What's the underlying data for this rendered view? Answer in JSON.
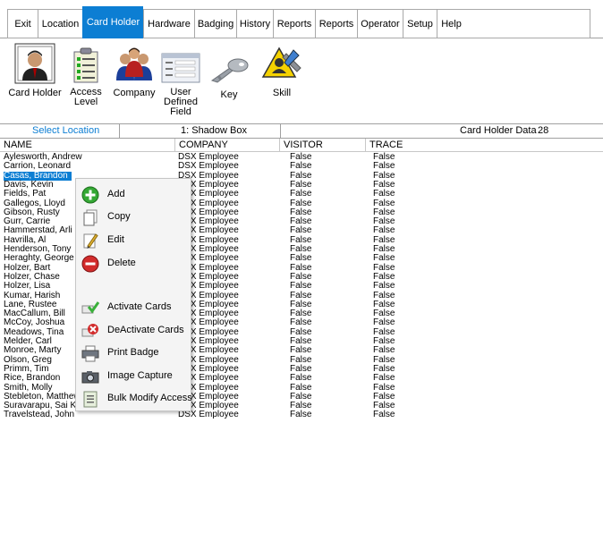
{
  "menu": {
    "tabs": [
      "Exit",
      "Location",
      "Card Holder",
      "Hardware",
      "Badging",
      "History",
      "Reports",
      "Reports",
      "Operator",
      "Setup",
      "Help"
    ],
    "active_tab": "Card Holder",
    "accent_color": "#0c7ed3"
  },
  "ribbon": {
    "buttons": [
      {
        "label": "Card Holder",
        "icon": "person-icon"
      },
      {
        "label": "Access Level",
        "icon": "checklist-icon"
      },
      {
        "label": "Company",
        "icon": "group-icon"
      },
      {
        "label": "User Defined Field",
        "icon": "form-icon"
      },
      {
        "label": "Key",
        "icon": "key-icon"
      },
      {
        "label": "Skill",
        "icon": "skill-icon"
      }
    ]
  },
  "infobar": {
    "select_location": "Select Location",
    "location_value": "1: Shadow Box",
    "data_label": "Card Holder Data",
    "data_count": "28"
  },
  "grid": {
    "columns": [
      "NAME",
      "COMPANY",
      "VISITOR",
      "TRACE"
    ],
    "rows": [
      [
        "Aylesworth, Andrew",
        "DSX Employee",
        "False",
        "False"
      ],
      [
        "Carrion, Leonard",
        "DSX Employee",
        "False",
        "False"
      ],
      [
        "Casas, Brandon",
        "DSX Employee",
        "False",
        "False"
      ],
      [
        "Davis, Kevin",
        "DSX Employee",
        "False",
        "False"
      ],
      [
        "Fields, Pat",
        "DSX Employee",
        "False",
        "False"
      ],
      [
        "Gallegos, Lloyd",
        "DSX Employee",
        "False",
        "False"
      ],
      [
        "Gibson, Rusty",
        "DSX Employee",
        "False",
        "False"
      ],
      [
        "Gurr, Carrie",
        "DSX Employee",
        "False",
        "False"
      ],
      [
        "Hammerstad, Arli",
        "DSX Employee",
        "False",
        "False"
      ],
      [
        "Havrilla, Al",
        "DSX Employee",
        "False",
        "False"
      ],
      [
        "Henderson, Tony",
        "DSX Employee",
        "False",
        "False"
      ],
      [
        "Heraghty, George",
        "DSX Employee",
        "False",
        "False"
      ],
      [
        "Holzer, Bart",
        "DSX Employee",
        "False",
        "False"
      ],
      [
        "Holzer, Chase",
        "DSX Employee",
        "False",
        "False"
      ],
      [
        "Holzer, Lisa",
        "DSX Employee",
        "False",
        "False"
      ],
      [
        "Kumar, Harish",
        "DSX Employee",
        "False",
        "False"
      ],
      [
        "Lane, Rustee",
        "DSX Employee",
        "False",
        "False"
      ],
      [
        "MacCallum, Bill",
        "DSX Employee",
        "False",
        "False"
      ],
      [
        "McCoy, Joshua",
        "DSX Employee",
        "False",
        "False"
      ],
      [
        "Meadows, Tina",
        "DSX Employee",
        "False",
        "False"
      ],
      [
        "Melder, Carl",
        "DSX Employee",
        "False",
        "False"
      ],
      [
        "Monroe, Marty",
        "DSX Employee",
        "False",
        "False"
      ],
      [
        "Olson, Greg",
        "DSX Employee",
        "False",
        "False"
      ],
      [
        "Primm, Tim",
        "DSX Employee",
        "False",
        "False"
      ],
      [
        "Rice, Brandon",
        "DSX Employee",
        "False",
        "False"
      ],
      [
        "Smith, Molly",
        "DSX Employee",
        "False",
        "False"
      ],
      [
        "Stebleton, Matthew",
        "DSX Employee",
        "False",
        "False"
      ],
      [
        "Suravarapu, Sai Kiran",
        "DSX Employee",
        "False",
        "False"
      ],
      [
        "Travelstead, John",
        "DSX Employee",
        "False",
        "False"
      ]
    ],
    "selected_row": 2,
    "selection_color": "#0c7ed3"
  },
  "context_menu": {
    "items": [
      {
        "label": "Add",
        "icon": "add-icon"
      },
      {
        "label": "Copy",
        "icon": "copy-icon"
      },
      {
        "label": "Edit",
        "icon": "edit-icon"
      },
      {
        "label": "Delete",
        "icon": "delete-icon"
      },
      {
        "label": "Activate Cards",
        "icon": "activate-cards-icon"
      },
      {
        "label": "DeActivate Cards",
        "icon": "deactivate-cards-icon"
      },
      {
        "label": "Print Badge",
        "icon": "printer-icon"
      },
      {
        "label": "Image Capture",
        "icon": "camera-icon"
      },
      {
        "label": "Bulk Modify Access",
        "icon": "bulk-modify-icon"
      }
    ]
  }
}
